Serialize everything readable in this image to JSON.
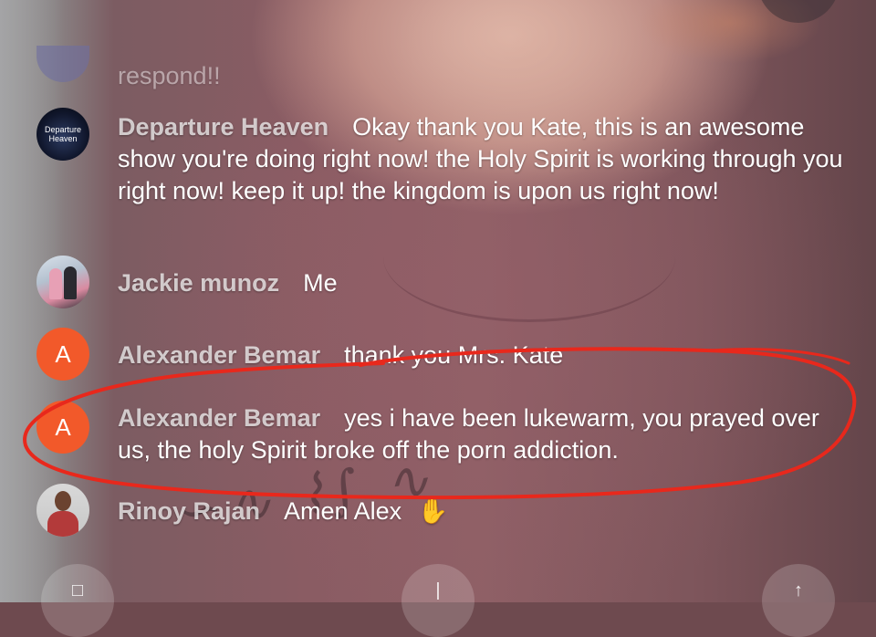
{
  "comments": [
    {
      "author": "",
      "text": "respond!!",
      "avatar": {
        "kind": "partial"
      }
    },
    {
      "author": "Departure Heaven",
      "text": "Okay thank you Kate, this is an awesome show you're doing right now! the Holy Spirit is working through you right now! keep it up! the kingdom is upon us right now!",
      "avatar": {
        "kind": "photo",
        "label": "Departure Heaven"
      }
    },
    {
      "author": "Jackie munoz",
      "text": "Me",
      "avatar": {
        "kind": "photo"
      }
    },
    {
      "author": "Alexander Bemar",
      "text": "thank you Mrs. Kate",
      "avatar": {
        "kind": "letter",
        "letter": "A",
        "color": "#f2592a"
      }
    },
    {
      "author": "Alexander Bemar",
      "text": "yes i have been lukewarm, you prayed over us, the holy Spirit broke off the porn addiction.",
      "avatar": {
        "kind": "letter",
        "letter": "A",
        "color": "#f2592a"
      }
    },
    {
      "author": "Rinoy Rajan",
      "text": "Amen Alex",
      "emoji": "✋",
      "avatar": {
        "kind": "photo"
      }
    }
  ],
  "colors": {
    "annotation": "#e8281c",
    "letter_avatar": "#f2592a"
  }
}
